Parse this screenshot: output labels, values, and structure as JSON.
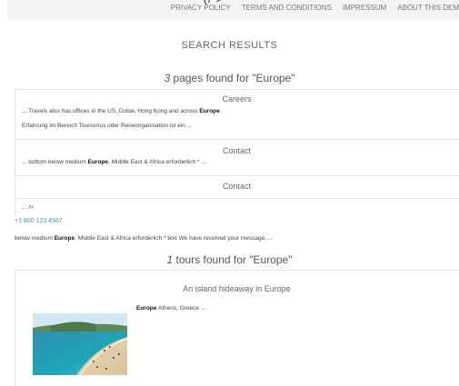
{
  "header": {
    "logo_fragment": "(/ >",
    "links": [
      "PRIVACY POLICY",
      "TERMS AND CONDITIONS",
      "IMPRESSUM",
      "ABOUT THIS DEM"
    ]
  },
  "search": {
    "title": "SEARCH RESULTS",
    "query": "Europe"
  },
  "pages": {
    "count": "3",
    "summary": " pages found for \"Europe\"",
    "results": [
      {
        "title": "Careers",
        "lines": [
          {
            "before": "... Travels also has offices in the US, Dubai, Hong Kong and across ",
            "highlight": "Europe",
            "after": "."
          },
          {
            "before": "Erfahrung im Bereich Tourismus oder Reiseorganisation ist ein ...",
            "highlight": "",
            "after": ""
          }
        ]
      },
      {
        "title": "Contact",
        "lines": [
          {
            "before": "... bottom below medium ",
            "highlight": "Europe",
            "after": ", Middle East & Africa erforderlich * ..."
          }
        ]
      },
      {
        "title": "Contact",
        "lines": [
          {
            "before": "... />",
            "highlight": "",
            "after": ""
          }
        ]
      }
    ],
    "phone": "+1 800 123 4567",
    "trailing_snippet": {
      "before": "below medium ",
      "highlight": "Europe",
      "after": ", Middle East & Africa erforderlich * text We have received your message, ..."
    }
  },
  "tours": {
    "count": "1",
    "summary": " tours found for \"Europe\"",
    "results": [
      {
        "title": "An island hideaway in Europe",
        "text_highlight": "Europe",
        "text_after": " Athens, Greece ..."
      }
    ]
  },
  "colors": {
    "link": "#4a90c4",
    "border": "#e4e4e4",
    "topbar": "#f4f4f4"
  }
}
